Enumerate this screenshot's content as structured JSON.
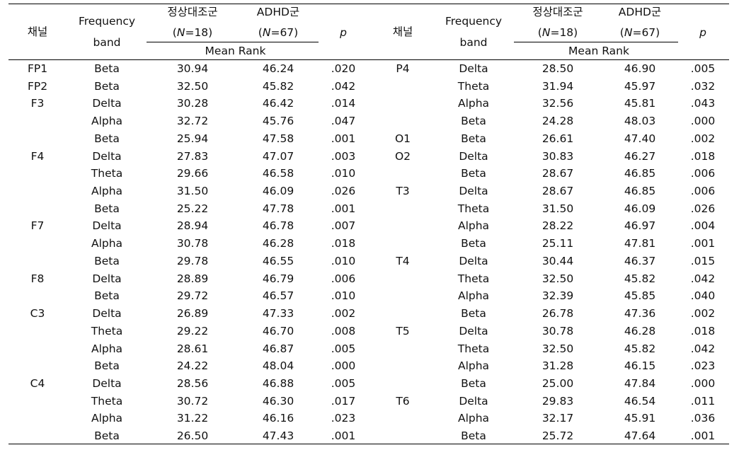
{
  "header": {
    "channel": "채널",
    "band_line1": "Frequency",
    "band_line2": "band",
    "control_group": "정상대조군",
    "control_n_open": "(",
    "control_n_italic": "N",
    "control_n_rest": "=18)",
    "adhd_group": "ADHD군",
    "adhd_n_open": "(",
    "adhd_n_italic": "N",
    "adhd_n_rest": "=67)",
    "mean_rank": "Mean  Rank",
    "p": "p"
  },
  "left_rows": [
    [
      "FP1",
      "Beta",
      "30.94",
      "46.24",
      ".020"
    ],
    [
      "FP2",
      "Beta",
      "32.50",
      "45.82",
      ".042"
    ],
    [
      "F3",
      "Delta",
      "30.28",
      "46.42",
      ".014"
    ],
    [
      "",
      "Alpha",
      "32.72",
      "45.76",
      ".047"
    ],
    [
      "",
      "Beta",
      "25.94",
      "47.58",
      ".001"
    ],
    [
      "F4",
      "Delta",
      "27.83",
      "47.07",
      ".003"
    ],
    [
      "",
      "Theta",
      "29.66",
      "46.58",
      ".010"
    ],
    [
      "",
      "Alpha",
      "31.50",
      "46.09",
      ".026"
    ],
    [
      "",
      "Beta",
      "25.22",
      "47.78",
      ".001"
    ],
    [
      "F7",
      "Delta",
      "28.94",
      "46.78",
      ".007"
    ],
    [
      "",
      "Alpha",
      "30.78",
      "46.28",
      ".018"
    ],
    [
      "",
      "Beta",
      "29.78",
      "46.55",
      ".010"
    ],
    [
      "F8",
      "Delta",
      "28.89",
      "46.79",
      ".006"
    ],
    [
      "",
      "Beta",
      "29.72",
      "46.57",
      ".010"
    ],
    [
      "C3",
      "Delta",
      "26.89",
      "47.33",
      ".002"
    ],
    [
      "",
      "Theta",
      "29.22",
      "46.70",
      ".008"
    ],
    [
      "",
      "Alpha",
      "28.61",
      "46.87",
      ".005"
    ],
    [
      "",
      "Beta",
      "24.22",
      "48.04",
      ".000"
    ],
    [
      "C4",
      "Delta",
      "28.56",
      "46.88",
      ".005"
    ],
    [
      "",
      "Theta",
      "30.72",
      "46.30",
      ".017"
    ],
    [
      "",
      "Alpha",
      "31.22",
      "46.16",
      ".023"
    ],
    [
      "",
      "Beta",
      "26.50",
      "47.43",
      ".001"
    ]
  ],
  "right_rows": [
    [
      "P4",
      "Delta",
      "28.50",
      "46.90",
      ".005"
    ],
    [
      "",
      "Theta",
      "31.94",
      "45.97",
      ".032"
    ],
    [
      "",
      "Alpha",
      "32.56",
      "45.81",
      ".043"
    ],
    [
      "",
      "Beta",
      "24.28",
      "48.03",
      ".000"
    ],
    [
      "O1",
      "Beta",
      "26.61",
      "47.40",
      ".002"
    ],
    [
      "O2",
      "Delta",
      "30.83",
      "46.27",
      ".018"
    ],
    [
      "",
      "Beta",
      "28.67",
      "46.85",
      ".006"
    ],
    [
      "T3",
      "Delta",
      "28.67",
      "46.85",
      ".006"
    ],
    [
      "",
      "Theta",
      "31.50",
      "46.09",
      ".026"
    ],
    [
      "",
      "Alpha",
      "28.22",
      "46.97",
      ".004"
    ],
    [
      "",
      "Beta",
      "25.11",
      "47.81",
      ".001"
    ],
    [
      "T4",
      "Delta",
      "30.44",
      "46.37",
      ".015"
    ],
    [
      "",
      "Theta",
      "32.50",
      "45.82",
      ".042"
    ],
    [
      "",
      "Alpha",
      "32.39",
      "45.85",
      ".040"
    ],
    [
      "",
      "Beta",
      "26.78",
      "47.36",
      ".002"
    ],
    [
      "T5",
      "Delta",
      "30.78",
      "46.28",
      ".018"
    ],
    [
      "",
      "Theta",
      "32.50",
      "45.82",
      ".042"
    ],
    [
      "",
      "Alpha",
      "31.28",
      "46.15",
      ".023"
    ],
    [
      "",
      "Beta",
      "25.00",
      "47.84",
      ".000"
    ],
    [
      "T6",
      "Delta",
      "29.83",
      "46.54",
      ".011"
    ],
    [
      "",
      "Alpha",
      "32.17",
      "45.91",
      ".036"
    ],
    [
      "",
      "Beta",
      "25.72",
      "47.64",
      ".001"
    ]
  ]
}
